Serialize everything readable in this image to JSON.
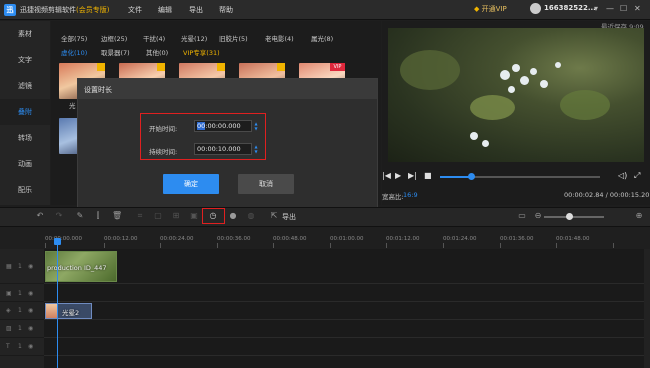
{
  "app": {
    "logo": "迅",
    "title": "迅捷视频剪辑软件",
    "edition": "(会员专版)",
    "menus": [
      "文件",
      "编辑",
      "导出",
      "帮助"
    ],
    "vip_button": "开通VIP",
    "username": "166382522...",
    "last_saved": "最近保存 9:09"
  },
  "nav": {
    "items": [
      "素材",
      "文字",
      "滤镜",
      "叠附",
      "转场",
      "动画",
      "配乐"
    ],
    "active_index": 3
  },
  "resources": {
    "categories_row1": [
      "全部(75)",
      "边框(25)",
      "干扰(4)",
      "光晕(12)",
      "旧胶片(5)",
      "老电影(4)",
      "属光(8)"
    ],
    "categories_row2": [
      "虚化(10)",
      "取景器(7)",
      "其他(0)",
      "VIP专享(31)"
    ],
    "thumb_labels": [
      "光"
    ]
  },
  "dialog": {
    "title": "设置时长",
    "start_label": "开始时间:",
    "start_value_highlight": "00",
    "start_value_rest": ":00:00.000",
    "duration_label": "持续时间:",
    "duration_value": "00:00:10.000",
    "ok_label": "确定",
    "cancel_label": "取消"
  },
  "preview": {
    "ratio_label": "宽高比:",
    "ratio_value": "16:9",
    "timecode": "00:00:02.84 / 00:00:15.20",
    "progress_fraction": 0.19
  },
  "toolbar": {
    "export_label": "导出"
  },
  "timeline": {
    "ticks": [
      "00:00:00.000",
      "00:00:12.00",
      "00:00:24.00",
      "00:00:36.00",
      "00:00:48.00",
      "00:01:00.00",
      "00:01:12.00",
      "00:01:24.00",
      "00:01:36.00",
      "00:01:48.00"
    ],
    "video_clip_label": "production ID_447",
    "effect_clip_label": "光晕2",
    "track_labels": [
      "1",
      "1",
      "1",
      "1",
      "1"
    ]
  },
  "colors": {
    "accent": "#2d8cf0",
    "highlight_box": "#e02020",
    "vip": "#f0b400"
  }
}
